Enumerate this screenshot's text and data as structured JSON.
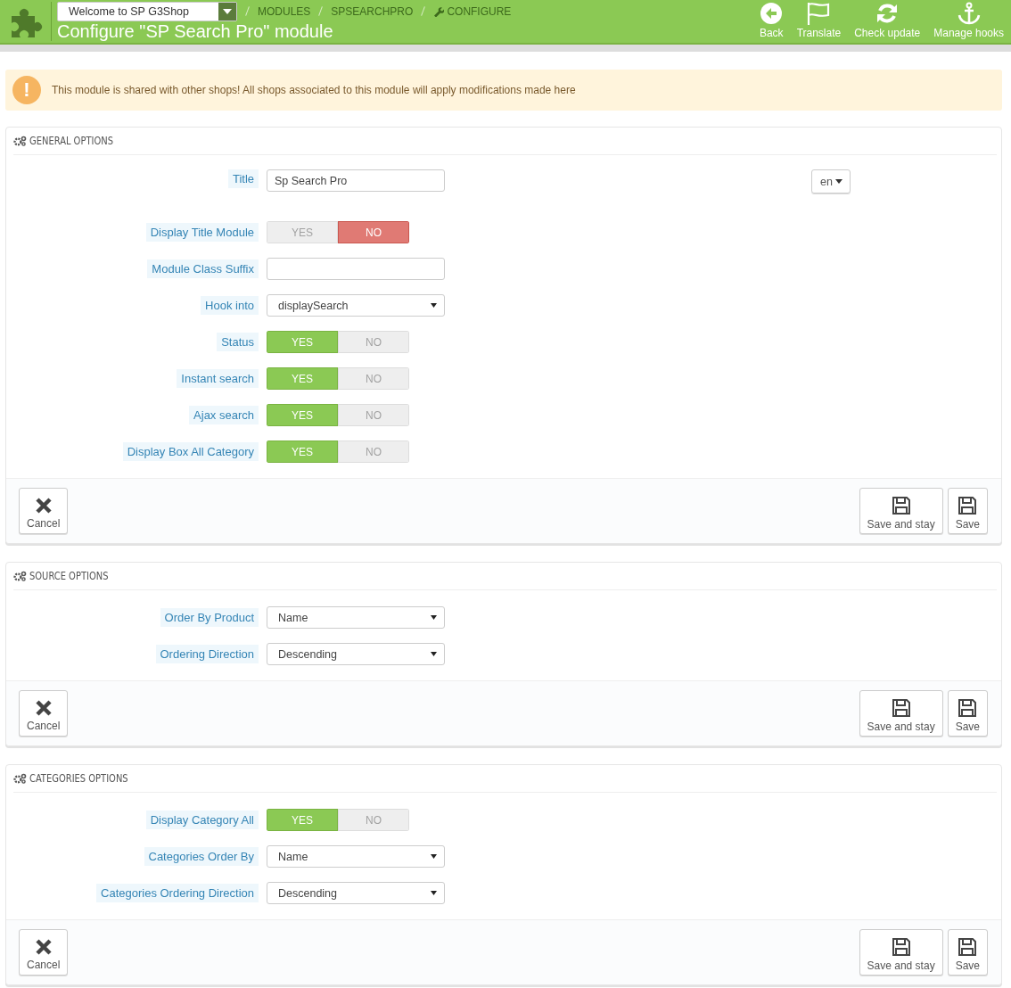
{
  "header": {
    "shop_select": "Welcome to SP G3Shop",
    "breadcrumb": [
      "MODULES",
      "SPSEARCHPRO",
      "CONFIGURE"
    ],
    "title": "Configure \"SP Search Pro\" module",
    "toolbar": [
      {
        "label": "Back",
        "kind": "back"
      },
      {
        "label": "Translate",
        "kind": "flag"
      },
      {
        "label": "Check update",
        "kind": "refresh"
      },
      {
        "label": "Manage hooks",
        "kind": "anchor"
      }
    ]
  },
  "alert": {
    "icon": "!",
    "text": "This module is shared with other shops! All shops associated to this module will apply modifications made here"
  },
  "panels": [
    {
      "title": "GENERAL OPTIONS",
      "fields": [
        {
          "kind": "text",
          "label": "Title",
          "value": "Sp Search Pro",
          "language": "en"
        },
        {
          "kind": "switch",
          "label": "Display Title Module",
          "yes": "YES",
          "no": "NO",
          "on": false
        },
        {
          "kind": "text",
          "label": "Module Class Suffix"
        },
        {
          "kind": "select",
          "label": "Hook into",
          "value": "displaySearch"
        },
        {
          "kind": "switch",
          "label": "Status",
          "yes": "YES",
          "no": "NO",
          "on": true
        },
        {
          "kind": "switch",
          "label": "Instant search",
          "yes": "YES",
          "no": "NO",
          "on": true
        },
        {
          "kind": "switch",
          "label": "Ajax search",
          "yes": "YES",
          "no": "NO",
          "on": true
        },
        {
          "kind": "switch",
          "label": "Display Box All Category",
          "yes": "YES",
          "no": "NO",
          "on": true
        }
      ],
      "buttons": {
        "cancel": "Cancel",
        "save_stay": "Save and stay",
        "save": "Save"
      }
    },
    {
      "title": "SOURCE OPTIONS",
      "fields": [
        {
          "kind": "select",
          "label": "Order By Product",
          "value": "Name"
        },
        {
          "kind": "select",
          "label": "Ordering Direction",
          "value": "Descending"
        }
      ],
      "buttons": {
        "cancel": "Cancel",
        "save_stay": "Save and stay",
        "save": "Save"
      }
    },
    {
      "title": "CATEGORIES OPTIONS",
      "fields": [
        {
          "kind": "switch",
          "label": "Display Category All",
          "yes": "YES",
          "no": "NO",
          "on": true
        },
        {
          "kind": "select",
          "label": "Categories Order By",
          "value": "Name"
        },
        {
          "kind": "select",
          "label": "Categories Ordering Direction",
          "value": "Descending"
        }
      ],
      "buttons": {
        "cancel": "Cancel",
        "save_stay": "Save and stay",
        "save": "Save"
      }
    }
  ]
}
